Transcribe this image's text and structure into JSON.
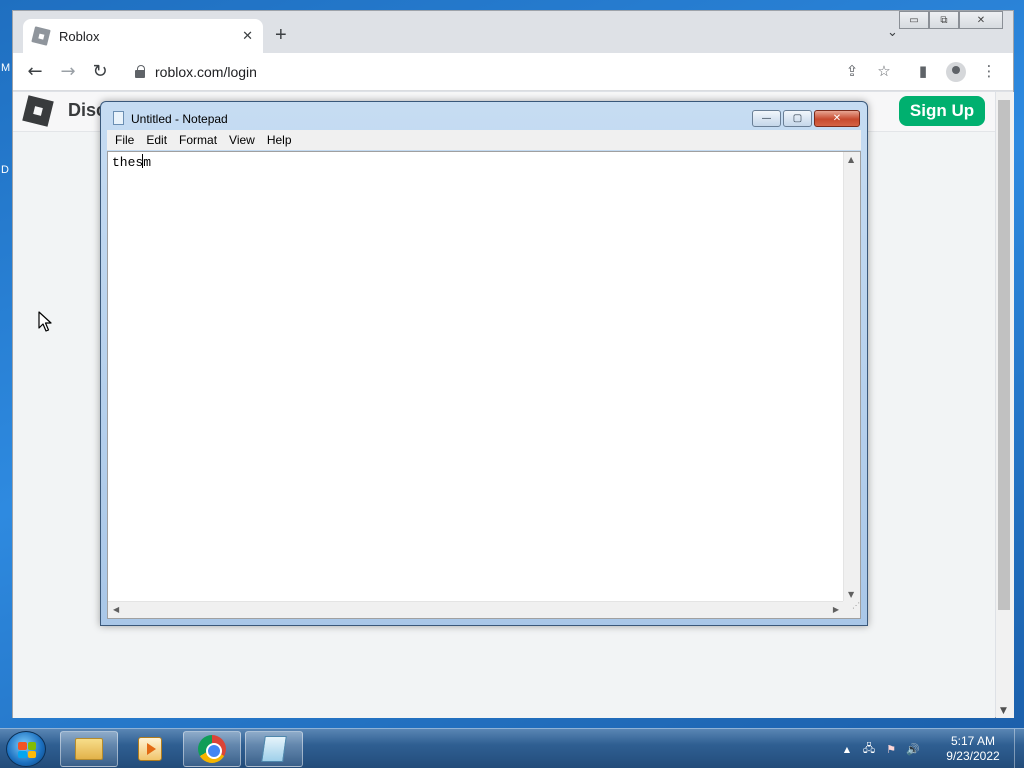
{
  "desktop": {
    "fragments": [
      "M",
      "D"
    ]
  },
  "browser": {
    "tab_title": "Roblox",
    "tab_close": "✕",
    "new_tab": "+",
    "tab_search": "⌄",
    "window_controls": {
      "minimize": "▭",
      "restore": "⧉",
      "close": "✕"
    },
    "nav": {
      "back": "←",
      "forward": "→",
      "reload": "↻"
    },
    "url": "roblox.com/login",
    "icons": {
      "share": "⇪",
      "bookmark": "☆",
      "sidepanel": "▮",
      "menu": "⋮"
    }
  },
  "page": {
    "header_text": "Disc",
    "signup_label": "Sign Up",
    "signup_color": "#00b06f"
  },
  "notepad": {
    "title": "Untitled - Notepad",
    "menu": [
      "File",
      "Edit",
      "Format",
      "View",
      "Help"
    ],
    "text_before_caret": "thes",
    "text_after_caret": "m",
    "controls": {
      "minimize": "—",
      "maximize": "▢",
      "close": "✕"
    }
  },
  "taskbar": {
    "time": "5:17 AM",
    "date": "9/23/2022",
    "tray": {
      "show_hidden": "▲",
      "network": "🖧",
      "flag": "⚑",
      "volume": "🔊"
    }
  }
}
